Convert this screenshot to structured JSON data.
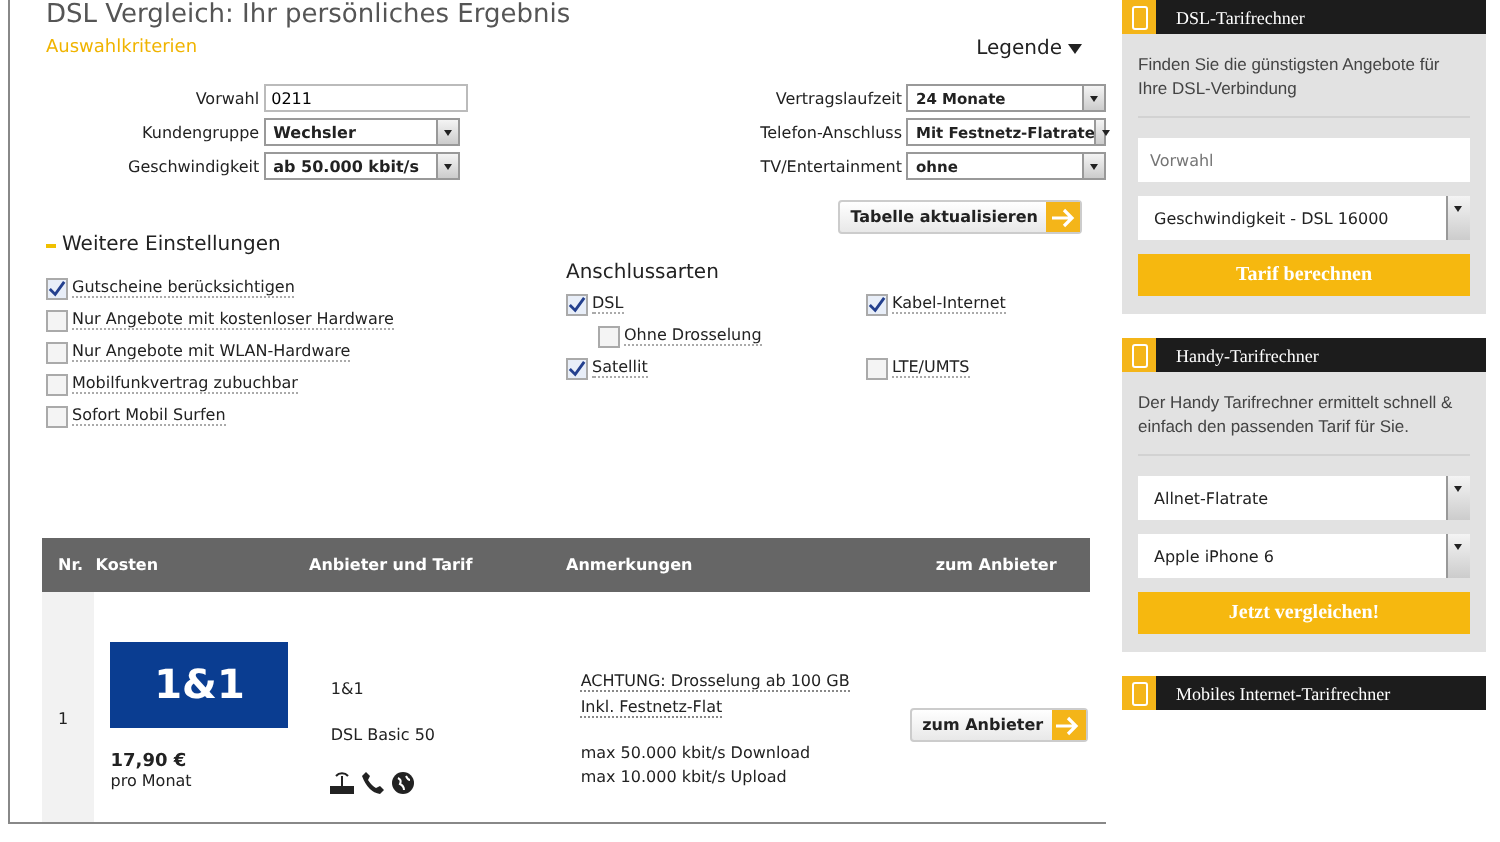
{
  "page_title": "DSL Vergleich: Ihr persönliches Ergebnis",
  "criteria": {
    "title": "Auswahlkriterien",
    "legend": "Legende",
    "fields_left": [
      {
        "label": "Vorwahl",
        "kind": "input",
        "value": "0211"
      },
      {
        "label": "Kundengruppe",
        "kind": "select",
        "value": "Wechsler"
      },
      {
        "label": "Geschwindigkeit",
        "kind": "select",
        "value": "ab 50.000 kbit/s"
      }
    ],
    "fields_right": [
      {
        "label": "Vertragslaufzeit",
        "kind": "select",
        "value": "24 Monate"
      },
      {
        "label": "Telefon-Anschluss",
        "kind": "select",
        "value": "Mit Festnetz-Flatrate"
      },
      {
        "label": "TV/Entertainment",
        "kind": "select",
        "value": "ohne"
      }
    ],
    "update_button": "Tabelle aktualisieren"
  },
  "more_settings": {
    "title": "Weitere Einstellungen",
    "options": [
      {
        "label": "Gutscheine berücksichtigen",
        "checked": true
      },
      {
        "label": "Nur Angebote mit kostenloser Hardware",
        "checked": false
      },
      {
        "label": "Nur Angebote mit WLAN-Hardware",
        "checked": false
      },
      {
        "label": "Mobilfunkvertrag zubuchbar",
        "checked": false
      },
      {
        "label": "Sofort Mobil Surfen",
        "checked": false
      }
    ]
  },
  "connection_types": {
    "title": "Anschlussarten",
    "options": [
      {
        "label": "DSL",
        "checked": true,
        "children": [
          {
            "label": "Ohne Drosselung",
            "checked": false
          }
        ]
      },
      {
        "label": "Kabel-Internet",
        "checked": true
      },
      {
        "label": "Satellit",
        "checked": true
      },
      {
        "label": "LTE/UMTS",
        "checked": false
      }
    ]
  },
  "table": {
    "columns": [
      "Nr.",
      "Kosten",
      "Anbieter und Tarif",
      "Anmerkungen",
      "zum Anbieter"
    ],
    "rows": [
      {
        "nr": "1",
        "logo": "1&1",
        "price": "17,90 €",
        "price_unit": "pro Monat",
        "provider": "1&1",
        "tariff": "DSL Basic 50",
        "notes": [
          "ACHTUNG: Drosselung ab 100 GB",
          "Inkl. Festnetz-Flat"
        ],
        "specs": [
          "max 50.000 kbit/s Download",
          "max 10.000 kbit/s Upload"
        ],
        "button": "zum Anbieter"
      }
    ]
  },
  "sidebar": [
    {
      "title": "DSL-Tarifrechner",
      "description": "Finden Sie die günstigsten Angebote für Ihre DSL-Verbindung",
      "fields": [
        {
          "kind": "input",
          "placeholder": "Vorwahl"
        },
        {
          "kind": "select",
          "value": "Geschwindigkeit - DSL 16000"
        }
      ],
      "button": "Tarif berechnen"
    },
    {
      "title": "Handy-Tarifrechner",
      "description": "Der Handy Tarifrechner ermittelt schnell & einfach den passenden Tarif für Sie.",
      "fields": [
        {
          "kind": "select",
          "value": "Allnet-Flatrate"
        },
        {
          "kind": "select",
          "value": "Apple iPhone 6"
        }
      ],
      "button": "Jetzt vergleichen!"
    },
    {
      "title": "Mobiles Internet-Tarifrechner"
    }
  ]
}
